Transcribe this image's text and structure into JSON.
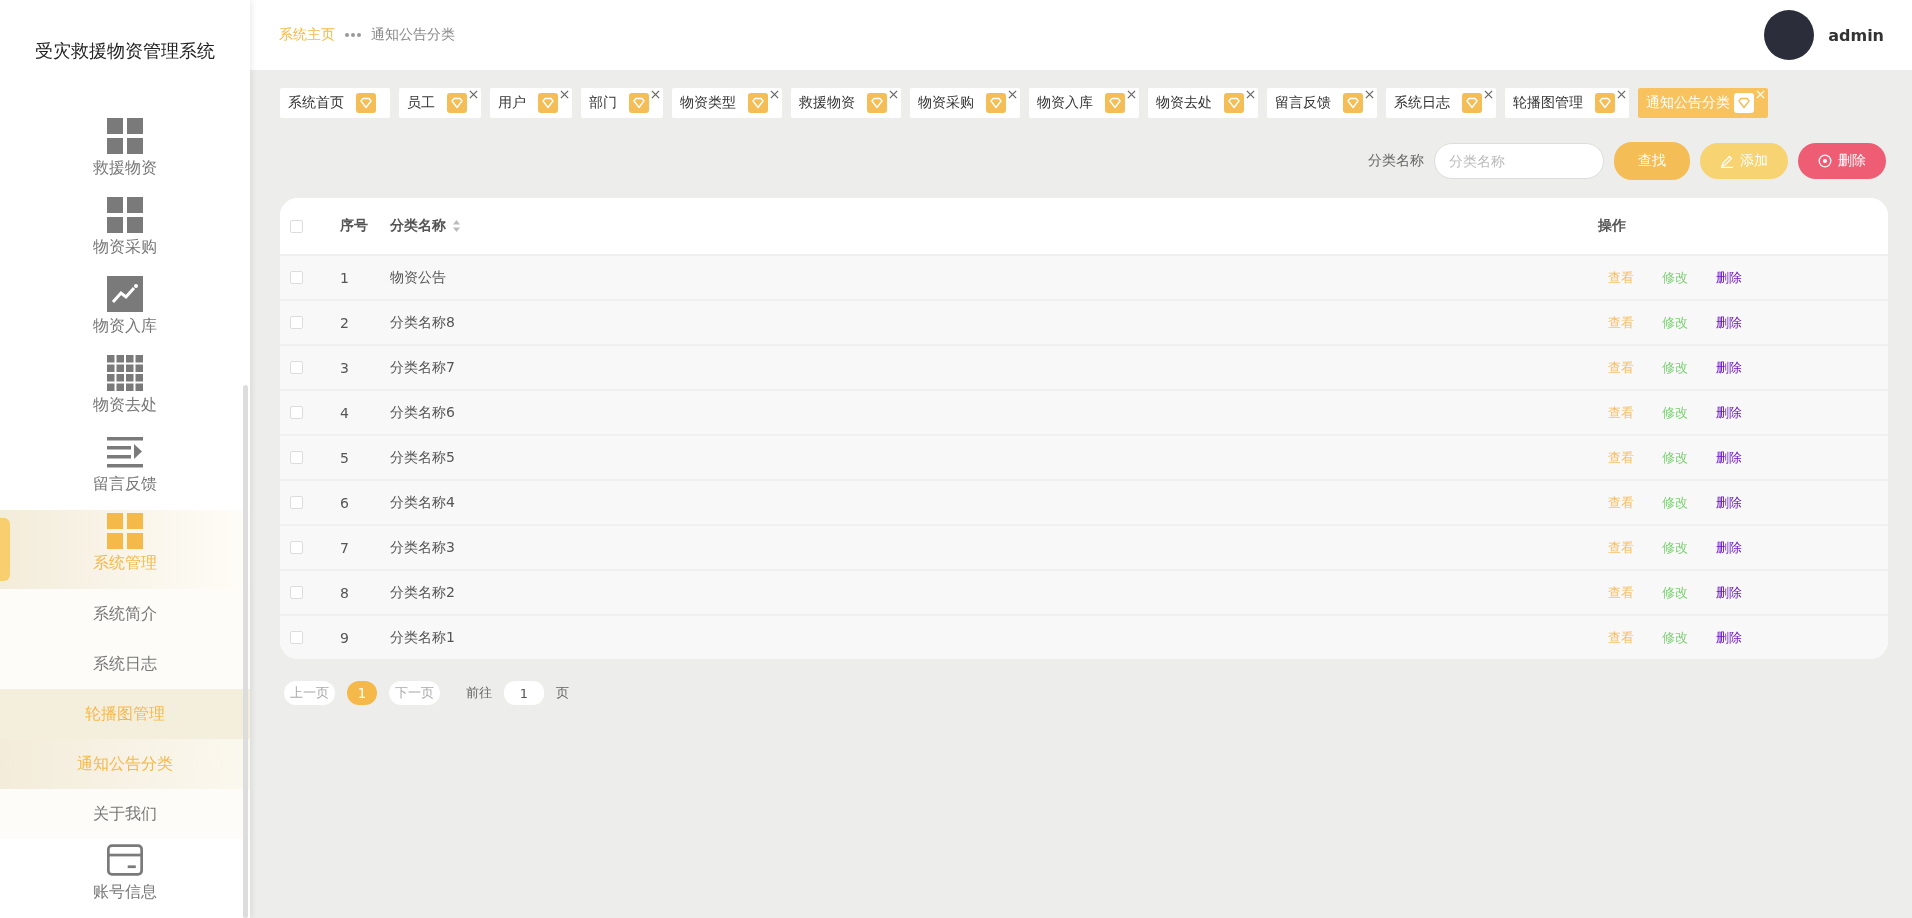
{
  "sidebar": {
    "title": "受灾救援物资管理系统",
    "items": [
      {
        "label": "救援物资",
        "kind": "grid4",
        "selected": false
      },
      {
        "label": "物资采购",
        "kind": "grid4",
        "selected": false
      },
      {
        "label": "物资入库",
        "kind": "chart",
        "selected": false
      },
      {
        "label": "物资去处",
        "kind": "grid9",
        "selected": false
      },
      {
        "label": "留言反馈",
        "kind": "list",
        "selected": false
      },
      {
        "label": "系统管理",
        "kind": "grid4",
        "selected": true,
        "children": [
          {
            "label": "系统简介",
            "selected": false,
            "hovered": false
          },
          {
            "label": "系统日志",
            "selected": false,
            "hovered": false
          },
          {
            "label": "轮播图管理",
            "selected": false,
            "hovered": true
          },
          {
            "label": "通知公告分类",
            "selected": true,
            "hovered": false
          },
          {
            "label": "关于我们",
            "selected": false,
            "hovered": false
          }
        ]
      },
      {
        "label": "账号信息",
        "kind": "card",
        "selected": false
      }
    ]
  },
  "header": {
    "breadcrumb": [
      "系统主页",
      "通知公告分类"
    ],
    "user": "admin"
  },
  "tabs": [
    {
      "label": "系统首页",
      "selected": false,
      "closable": false
    },
    {
      "label": "员工",
      "selected": false,
      "closable": true
    },
    {
      "label": "用户",
      "selected": false,
      "closable": true
    },
    {
      "label": "部门",
      "selected": false,
      "closable": true
    },
    {
      "label": "物资类型",
      "selected": false,
      "closable": true
    },
    {
      "label": "救援物资",
      "selected": false,
      "closable": true
    },
    {
      "label": "物资采购",
      "selected": false,
      "closable": true
    },
    {
      "label": "物资入库",
      "selected": false,
      "closable": true
    },
    {
      "label": "物资去处",
      "selected": false,
      "closable": true
    },
    {
      "label": "留言反馈",
      "selected": false,
      "closable": true
    },
    {
      "label": "系统日志",
      "selected": false,
      "closable": true
    },
    {
      "label": "轮播图管理",
      "selected": false,
      "closable": true
    },
    {
      "label": "通知公告分类",
      "selected": true,
      "closable": true
    }
  ],
  "search": {
    "label": "分类名称",
    "placeholder": "分类名称",
    "buttons": [
      {
        "label": "查找",
        "kind": "search"
      },
      {
        "label": "添加",
        "kind": "add"
      },
      {
        "label": "删除",
        "kind": "delete"
      }
    ]
  },
  "table": {
    "columns": [
      {
        "label": "序号",
        "sortable": false
      },
      {
        "label": "分类名称",
        "sortable": true
      },
      {
        "label": "操作",
        "sortable": false
      }
    ],
    "header_checked": false,
    "rows": [
      {
        "index": "1",
        "name": "物资公告",
        "checked": false,
        "actions": [
          {
            "label": "查看",
            "kind": "view"
          },
          {
            "label": "修改",
            "kind": "edit"
          },
          {
            "label": "删除",
            "kind": "delete"
          }
        ]
      },
      {
        "index": "2",
        "name": "分类名称8",
        "checked": false,
        "actions": [
          {
            "label": "查看",
            "kind": "view"
          },
          {
            "label": "修改",
            "kind": "edit"
          },
          {
            "label": "删除",
            "kind": "delete"
          }
        ]
      },
      {
        "index": "3",
        "name": "分类名称7",
        "checked": false,
        "actions": [
          {
            "label": "查看",
            "kind": "view"
          },
          {
            "label": "修改",
            "kind": "edit"
          },
          {
            "label": "删除",
            "kind": "delete"
          }
        ]
      },
      {
        "index": "4",
        "name": "分类名称6",
        "checked": false,
        "actions": [
          {
            "label": "查看",
            "kind": "view"
          },
          {
            "label": "修改",
            "kind": "edit"
          },
          {
            "label": "删除",
            "kind": "delete"
          }
        ]
      },
      {
        "index": "5",
        "name": "分类名称5",
        "checked": false,
        "actions": [
          {
            "label": "查看",
            "kind": "view"
          },
          {
            "label": "修改",
            "kind": "edit"
          },
          {
            "label": "删除",
            "kind": "delete"
          }
        ]
      },
      {
        "index": "6",
        "name": "分类名称4",
        "checked": false,
        "actions": [
          {
            "label": "查看",
            "kind": "view"
          },
          {
            "label": "修改",
            "kind": "edit"
          },
          {
            "label": "删除",
            "kind": "delete"
          }
        ]
      },
      {
        "index": "7",
        "name": "分类名称3",
        "checked": false,
        "actions": [
          {
            "label": "查看",
            "kind": "view"
          },
          {
            "label": "修改",
            "kind": "edit"
          },
          {
            "label": "删除",
            "kind": "delete"
          }
        ]
      },
      {
        "index": "8",
        "name": "分类名称2",
        "checked": false,
        "actions": [
          {
            "label": "查看",
            "kind": "view"
          },
          {
            "label": "修改",
            "kind": "edit"
          },
          {
            "label": "删除",
            "kind": "delete"
          }
        ]
      },
      {
        "index": "9",
        "name": "分类名称1",
        "checked": false,
        "actions": [
          {
            "label": "查看",
            "kind": "view"
          },
          {
            "label": "修改",
            "kind": "edit"
          },
          {
            "label": "删除",
            "kind": "delete"
          }
        ]
      }
    ]
  },
  "pagination": {
    "prev": "上一页",
    "pages": [
      {
        "label": "1",
        "selected": true
      }
    ],
    "next": "下一页",
    "goto_label": "前往",
    "goto_value": "1",
    "goto_suffix": "页"
  }
}
